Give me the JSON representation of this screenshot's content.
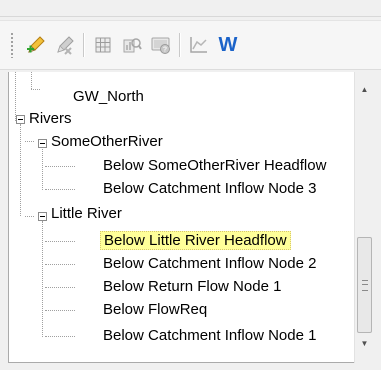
{
  "toolbar": {
    "items": [
      {
        "icon": "add-node-pencil-icon"
      },
      {
        "icon": "remove-node-pencil-icon"
      },
      {
        "icon": "table-grid-icon"
      },
      {
        "icon": "chart-view-icon"
      },
      {
        "icon": "help-query-icon"
      },
      {
        "icon": "line-chart-icon"
      },
      {
        "icon": "w-icon",
        "text": "W"
      }
    ]
  },
  "tree": {
    "nodes": [
      {
        "label": "GW_North",
        "level": 2,
        "selected": false
      },
      {
        "label": "Rivers",
        "level": 0,
        "expanded": true
      },
      {
        "label": "SomeOtherRiver",
        "level": 1,
        "expanded": true
      },
      {
        "label": "Below SomeOtherRiver Headflow",
        "level": 2,
        "selected": false
      },
      {
        "label": "Below Catchment Inflow Node 3",
        "level": 2,
        "selected": false
      },
      {
        "label": "Little River",
        "level": 1,
        "expanded": true
      },
      {
        "label": "Below Little River Headflow",
        "level": 2,
        "selected": true
      },
      {
        "label": "Below Catchment Inflow Node 2",
        "level": 2,
        "selected": false
      },
      {
        "label": "Below Return Flow Node 1",
        "level": 2,
        "selected": false
      },
      {
        "label": "Below FlowReq",
        "level": 2,
        "selected": false
      },
      {
        "label": "Below Catchment Inflow Node 1",
        "level": 2,
        "selected": false
      }
    ]
  },
  "colors": {
    "selection_highlight": "#ffff99",
    "w_icon_blue": "#1b63c9"
  }
}
